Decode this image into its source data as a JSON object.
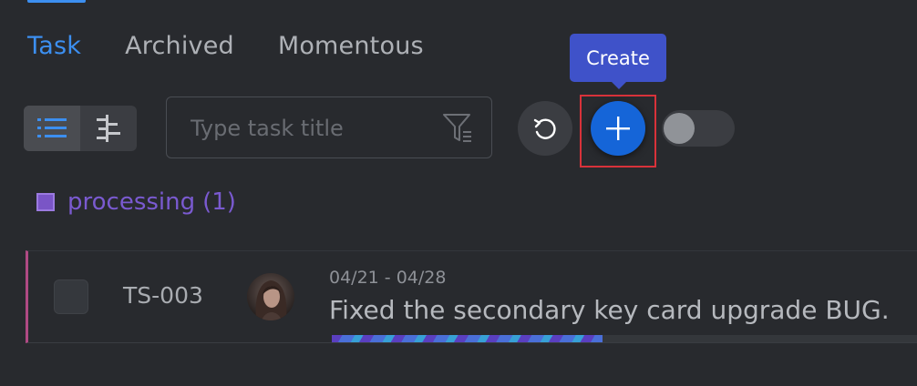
{
  "tabs": [
    {
      "label": "Task",
      "active": true
    },
    {
      "label": "Archived",
      "active": false
    },
    {
      "label": "Momentous",
      "active": false
    }
  ],
  "toolbar": {
    "view_modes": [
      "list-icon",
      "tree-icon"
    ],
    "active_view": "list",
    "search": {
      "placeholder": "Type task title",
      "value": ""
    },
    "refresh_icon": "refresh-icon",
    "create": {
      "tooltip": "Create",
      "icon": "plus-icon",
      "color": "#1565d8"
    },
    "switch": {
      "on": false
    }
  },
  "group": {
    "label": "processing",
    "count": "(1)",
    "color": "#7a55c6"
  },
  "tasks": [
    {
      "id": "TS-003",
      "date_range": "04/21 - 04/28",
      "title": "Fixed the secondary key card upgrade BUG.",
      "progress_pct": 46,
      "accent_color": "#b04a84"
    }
  ],
  "colors": {
    "active_tab": "#3c8ff0",
    "background": "#282a2e",
    "tooltip": "#3f52c9",
    "highlight": "#d8323a"
  }
}
